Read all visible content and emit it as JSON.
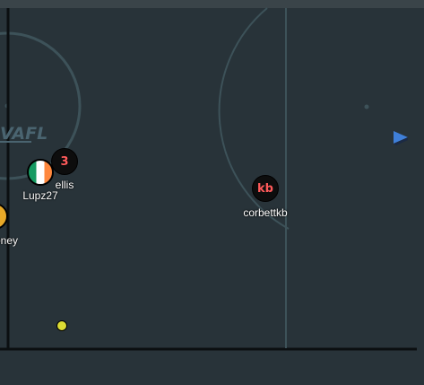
{
  "game": {
    "type": "haxball-style football",
    "field": {
      "background_color": "#283339",
      "line_color": "#3d5259",
      "boundary_color": "#000000",
      "logo_text": "VAFL"
    },
    "players": [
      {
        "nick": "ellis",
        "avatar": "3",
        "avatar_style": "black-disc",
        "avatar_color": "#ff5a5a"
      },
      {
        "nick": "Lupz27",
        "avatar": "",
        "avatar_style": "flag-disc-ireland"
      },
      {
        "nick": "looney",
        "avatar": "",
        "avatar_style": "orange-disc"
      },
      {
        "nick": "corbettkb",
        "avatar": "kb",
        "avatar_style": "black-disc",
        "avatar_color": "#ff5a5a"
      }
    ],
    "ball": {
      "color": "#dcdc34"
    },
    "offscreen_indicator": {
      "icon": "triangle-pointer-icon",
      "color": "#3f7fd8"
    }
  }
}
